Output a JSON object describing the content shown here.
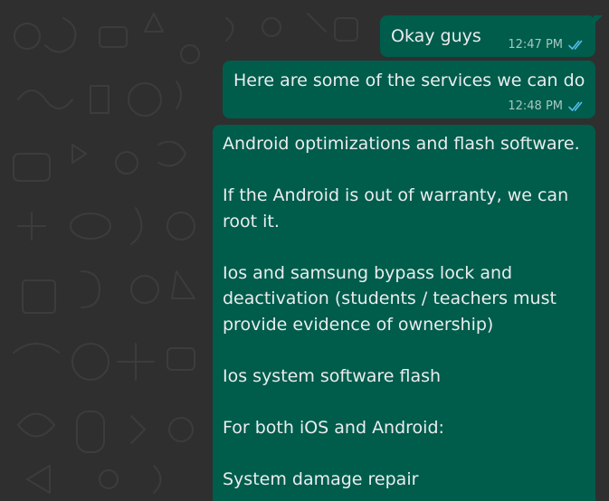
{
  "chat": {
    "messages": [
      {
        "text": "Okay guys",
        "time": "12:47 PM",
        "status_icon": "double-check-icon",
        "direction": "outgoing"
      },
      {
        "text": "Here are some of the services we can do",
        "time": "12:48 PM",
        "status_icon": "double-check-icon",
        "direction": "outgoing"
      },
      {
        "text": "Android optimizations and flash software.\n\nIf the Android is out of warranty, we can root it.\n\nIos and samsung bypass lock and deactivation (students / teachers must provide evidence of ownership)\n\nIos system software flash\n\nFor both iOS and Android:\n\nSystem damage repair",
        "direction": "outgoing"
      }
    ]
  },
  "colors": {
    "background": "#2f2f2f",
    "bubble_outgoing": "#005c4b",
    "text": "#e9edef",
    "timestamp": "#a6c8c0",
    "read_ticks": "#53bdeb"
  }
}
